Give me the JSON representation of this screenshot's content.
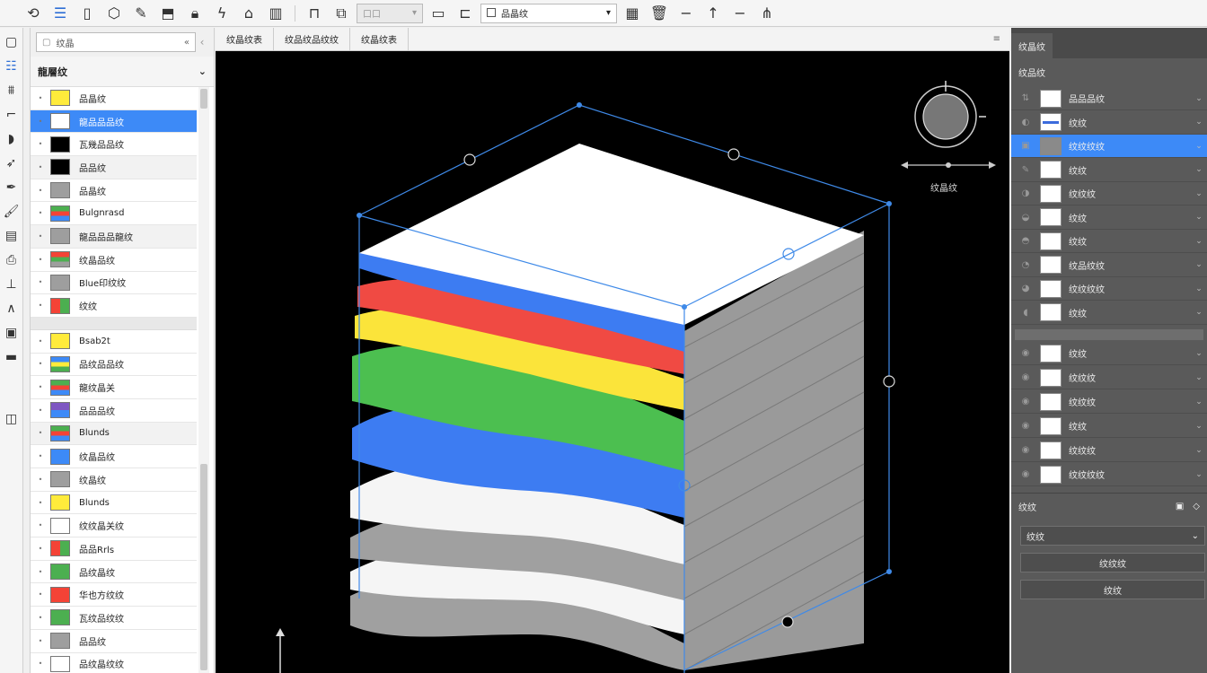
{
  "toolbar": {
    "layer_combo": "品晶纹",
    "disabled_combo": "口口"
  },
  "search": {
    "value": "纹晶",
    "collapse_icon": "chevron-double-left-icon"
  },
  "left_panel": {
    "title": "龍層纹",
    "items": [
      {
        "label": "品晶纹",
        "color": "#ffeb3b"
      },
      {
        "label": "龍品品品纹",
        "color": "#ffffff"
      },
      {
        "label": "瓦幾品品纹",
        "color": "#000000"
      },
      {
        "label": "品品纹",
        "color": "#000000"
      },
      {
        "label": "品晶纹",
        "color": "#9e9e9e"
      },
      {
        "label": "Bulgnrasd",
        "color": "multi-rgb"
      },
      {
        "label": "龍品品品龍纹",
        "color": "#9e9e9e"
      },
      {
        "label": "纹晶品纹",
        "color": "multi-green"
      },
      {
        "label": "Blue印纹纹",
        "color": "#9e9e9e"
      },
      {
        "label": "纹纹",
        "color": "multi-red"
      },
      {
        "label": "Bsab2t",
        "color": "#ffeb3b"
      },
      {
        "label": "品纹品品纹",
        "color": "multi-blue"
      },
      {
        "label": "龍纹晶关",
        "color": "multi-rgb"
      },
      {
        "label": "品品品纹",
        "color": "multi-purple"
      },
      {
        "label": "Blunds",
        "color": "multi-rgb"
      },
      {
        "label": "纹晶品纹",
        "color": "#3d8af7"
      },
      {
        "label": "纹晶纹",
        "color": "#9e9e9e"
      },
      {
        "label": "Blunds",
        "color": "#ffeb3b"
      },
      {
        "label": "纹纹晶关纹",
        "color": "#ffffff"
      },
      {
        "label": "品品Rrls",
        "color": "multi-red"
      },
      {
        "label": "品纹晶纹",
        "color": "#4caf50"
      },
      {
        "label": "华也方纹纹",
        "color": "#f44336"
      },
      {
        "label": "瓦纹品纹纹",
        "color": "#4caf50"
      },
      {
        "label": "品品纹",
        "color": "#9e9e9e"
      },
      {
        "label": "品纹晶纹纹",
        "color": "#ffffff"
      }
    ]
  },
  "viewport": {
    "tabs": [
      "纹晶纹表",
      "纹品纹品纹纹",
      "纹晶纹表"
    ],
    "compass_label": "纹晶纹"
  },
  "right_panel": {
    "tab": "纹晶纹",
    "title": "纹品纹",
    "rows_a": [
      {
        "label": "品品品纹",
        "swatch": "white"
      },
      {
        "label": "纹纹",
        "swatch": "line"
      },
      {
        "label": "纹纹纹纹",
        "swatch": "gray"
      },
      {
        "label": "纹纹",
        "swatch": "white"
      },
      {
        "label": "纹纹纹",
        "swatch": "white"
      },
      {
        "label": "纹纹",
        "swatch": "white"
      },
      {
        "label": "纹纹",
        "swatch": "white"
      },
      {
        "label": "纹品纹纹",
        "swatch": "white"
      },
      {
        "label": "纹纹纹纹",
        "swatch": "white"
      },
      {
        "label": "纹纹",
        "swatch": "white"
      }
    ],
    "rows_b": [
      {
        "label": "纹纹"
      },
      {
        "label": "纹纹纹"
      },
      {
        "label": "纹纹纹"
      },
      {
        "label": "纹纹"
      },
      {
        "label": "纹纹纹"
      },
      {
        "label": "纹纹纹纹"
      }
    ],
    "section_title": "纹纹",
    "select_value": "纹纹",
    "button_1": "纹纹纹",
    "button_2": "纹纹"
  },
  "colors": {
    "blue": "#3d8af7",
    "red": "#f44336",
    "yellow": "#ffeb3b",
    "green": "#4caf50",
    "gray": "#9e9e9e",
    "white": "#ffffff"
  }
}
